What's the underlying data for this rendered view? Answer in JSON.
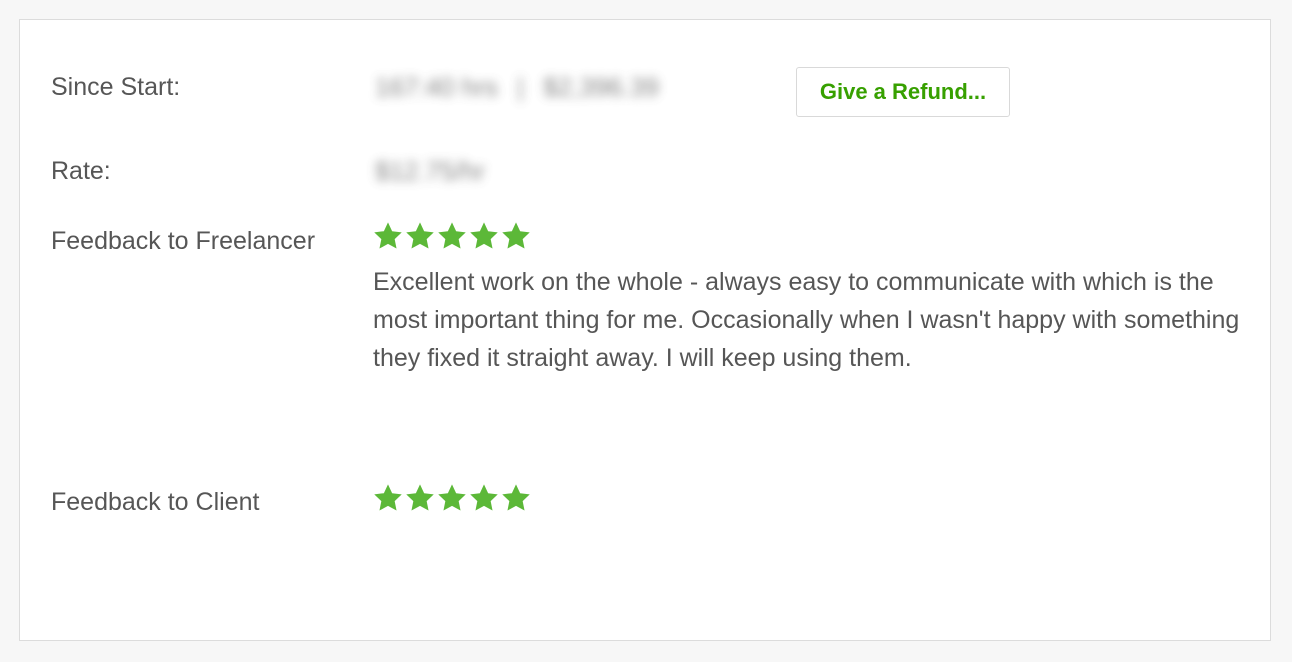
{
  "since_start": {
    "label": "Since Start:",
    "hours_value": "167:40 hrs",
    "separator": "|",
    "amount_value": "$2,396.39",
    "refund_button": "Give a Refund..."
  },
  "rate": {
    "label": "Rate:",
    "value": "$12.75/hr"
  },
  "feedback_freelancer": {
    "label": "Feedback to Freelancer",
    "rating": 5,
    "max_rating": 5,
    "comment": "Excellent work on the whole - always easy to communicate with which is the most important thing for me. Occasionally when I wasn't happy with something they fixed it straight away. I will keep using them."
  },
  "feedback_client": {
    "label": "Feedback to Client",
    "rating": 5,
    "max_rating": 5
  },
  "colors": {
    "star": "#5cb838",
    "accent": "#37a000",
    "text": "#565656"
  },
  "icons": {
    "star": "star-icon"
  }
}
